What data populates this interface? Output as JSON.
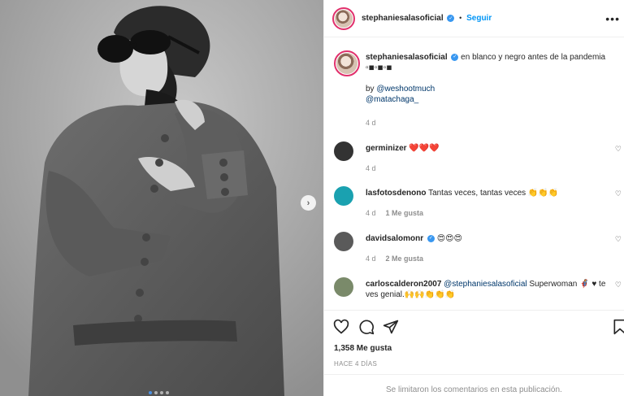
{
  "post": {
    "username": "stephaniesalasoficial",
    "follow_label": "Seguir",
    "separator": "•",
    "more_icon": "more-horizontal-icon",
    "caption_text": "en blanco y negro antes de la pandemia",
    "caption_symbols": "▫◾▫◾▫◾",
    "credit_by": "by",
    "credit_1": "@weshootmuch",
    "credit_2": "@matachaga_",
    "caption_time": "4 d"
  },
  "comments": [
    {
      "user": "germinizer",
      "text": "❤️❤️❤️",
      "time": "4 d",
      "likes": ""
    },
    {
      "user": "lasfotosdenono",
      "text": "Tantas veces, tantas veces 👏👏👏",
      "time": "4 d",
      "likes": "1 Me gusta"
    },
    {
      "user": "davidsalomonr",
      "text": "😍😍😍",
      "time": "4 d",
      "likes": "2 Me gusta"
    },
    {
      "user": "carloscalderon2007",
      "mention": "@stephaniesalasoficial",
      "text": "Superwoman 🦸‍♀️ ♥ te ves genial.🙌🙌👏👏👏"
    }
  ],
  "stats": {
    "likes_label": "1,358 Me gusta",
    "ago_label": "HACE 4 DÍAS"
  },
  "footer": {
    "notice": "Se limitaron los comentarios en esta publicación."
  },
  "carousel": {
    "next_icon": "chevron-right-icon",
    "next_glyph": "›",
    "position": 1,
    "count": 4
  }
}
